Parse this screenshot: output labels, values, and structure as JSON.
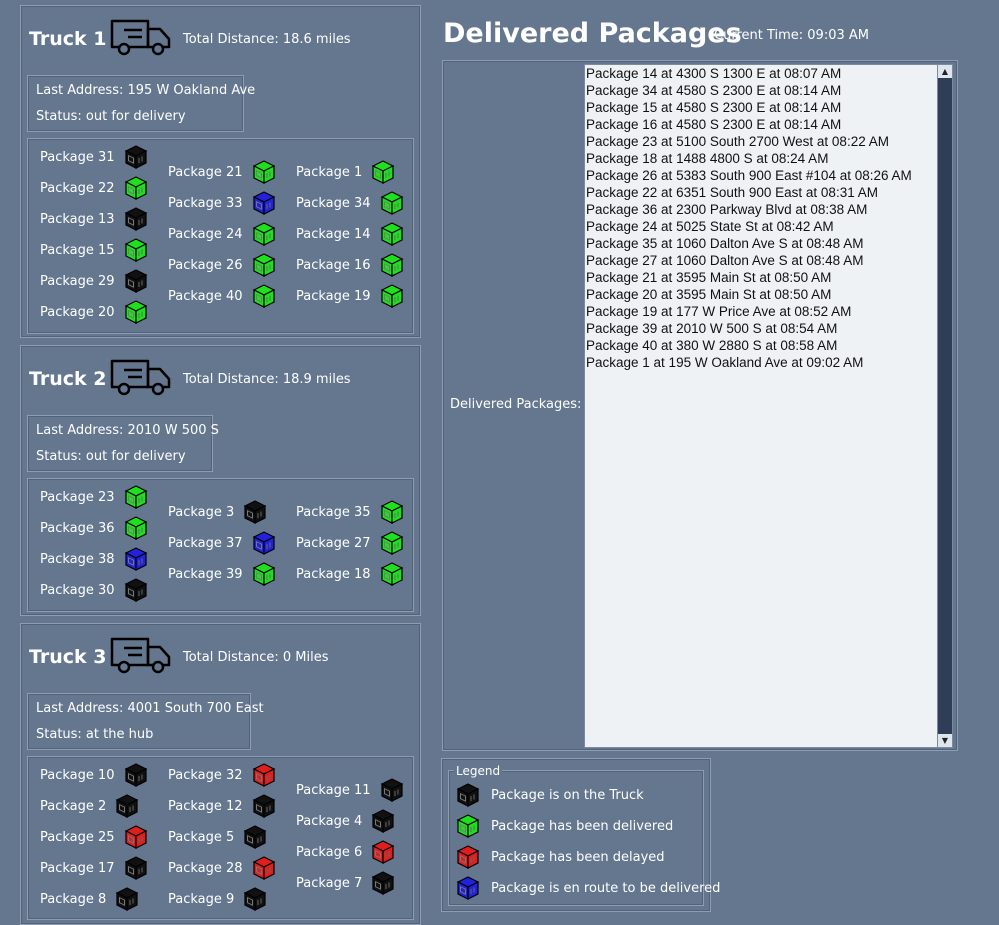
{
  "colors": {
    "bg": "#64778f",
    "onTruck": "#111111",
    "delivered": "#1ee01e",
    "delayed": "#e01e1e",
    "enroute": "#2222dd"
  },
  "trucks": [
    {
      "title": "Truck 1",
      "distance": "Total Distance: 18.6 miles",
      "last_address": "Last Address: 195 W Oakland Ave",
      "status": "Status: out for delivery",
      "columns": [
        [
          {
            "label": "Package 31",
            "state": "onTruck"
          },
          {
            "label": "Package 22",
            "state": "delivered"
          },
          {
            "label": "Package 13",
            "state": "onTruck"
          },
          {
            "label": "Package 15",
            "state": "delivered"
          },
          {
            "label": "Package 29",
            "state": "onTruck"
          },
          {
            "label": "Package 20",
            "state": "delivered"
          }
        ],
        [
          {
            "label": "Package 21",
            "state": "delivered"
          },
          {
            "label": "Package 33",
            "state": "enroute"
          },
          {
            "label": "Package 24",
            "state": "delivered"
          },
          {
            "label": "Package 26",
            "state": "delivered"
          },
          {
            "label": "Package 40",
            "state": "delivered"
          }
        ],
        [
          {
            "label": "Package 1",
            "state": "delivered"
          },
          {
            "label": "Package 34",
            "state": "delivered"
          },
          {
            "label": "Package 14",
            "state": "delivered"
          },
          {
            "label": "Package 16",
            "state": "delivered"
          },
          {
            "label": "Package 19",
            "state": "delivered"
          }
        ]
      ]
    },
    {
      "title": "Truck 2",
      "distance": "Total Distance: 18.9 miles",
      "last_address": "Last Address: 2010 W 500 S",
      "status": "Status: out for delivery",
      "columns": [
        [
          {
            "label": "Package 23",
            "state": "delivered"
          },
          {
            "label": "Package 36",
            "state": "delivered"
          },
          {
            "label": "Package 38",
            "state": "enroute"
          },
          {
            "label": "Package 30",
            "state": "onTruck"
          }
        ],
        [
          {
            "label": "Package 3",
            "state": "onTruck"
          },
          {
            "label": "Package 37",
            "state": "enroute"
          },
          {
            "label": "Package 39",
            "state": "delivered"
          }
        ],
        [
          {
            "label": "Package 35",
            "state": "delivered"
          },
          {
            "label": "Package 27",
            "state": "delivered"
          },
          {
            "label": "Package 18",
            "state": "delivered"
          }
        ]
      ]
    },
    {
      "title": "Truck 3",
      "distance": "Total Distance: 0 Miles",
      "last_address": "Last Address: 4001 South 700 East",
      "status": "Status: at the hub",
      "columns": [
        [
          {
            "label": "Package 10",
            "state": "onTruck"
          },
          {
            "label": "Package 2",
            "state": "onTruck"
          },
          {
            "label": "Package 25",
            "state": "delayed"
          },
          {
            "label": "Package 17",
            "state": "onTruck"
          },
          {
            "label": "Package 8",
            "state": "onTruck"
          }
        ],
        [
          {
            "label": "Package 32",
            "state": "delayed"
          },
          {
            "label": "Package 12",
            "state": "onTruck"
          },
          {
            "label": "Package 5",
            "state": "onTruck"
          },
          {
            "label": "Package 28",
            "state": "delayed"
          },
          {
            "label": "Package 9",
            "state": "onTruck"
          }
        ],
        [
          {
            "label": "Package 11",
            "state": "onTruck"
          },
          {
            "label": "Package 4",
            "state": "onTruck"
          },
          {
            "label": "Package 6",
            "state": "delayed"
          },
          {
            "label": "Package 7",
            "state": "onTruck"
          }
        ]
      ]
    }
  ],
  "header": {
    "title": "Delivered Packages",
    "current_time": "Current Time: 09:03 AM"
  },
  "delivered": {
    "label": "Delivered Packages:",
    "items": [
      "Package 14 at 4300 S 1300 E at 08:07 AM",
      "Package 34 at 4580 S 2300 E at 08:14 AM",
      "Package 15 at 4580 S 2300 E at 08:14 AM",
      "Package 16 at 4580 S 2300 E at 08:14 AM",
      "Package 23 at 5100 South 2700 West at 08:22 AM",
      "Package 18 at 1488 4800 S at 08:24 AM",
      "Package 26 at 5383 South 900 East #104 at 08:26 AM",
      "Package 22 at 6351 South 900 East at 08:31 AM",
      "Package 36 at 2300 Parkway Blvd at 08:38 AM",
      "Package 24 at 5025 State St at 08:42 AM",
      "Package 35 at 1060 Dalton Ave S at 08:48 AM",
      "Package 27 at 1060 Dalton Ave S at 08:48 AM",
      "Package 21 at 3595 Main St at 08:50 AM",
      "Package 20 at 3595 Main St at 08:50 AM",
      "Package 19 at 177 W Price Ave at 08:52 AM",
      "Package 39 at 2010 W 500 S at 08:54 AM",
      "Package 40 at 380 W 2880 S at 08:58 AM",
      "Package 1 at 195 W Oakland Ave at 09:02 AM"
    ]
  },
  "legend": {
    "title": "Legend",
    "items": [
      {
        "state": "onTruck",
        "label": "Package is on the Truck"
      },
      {
        "state": "delivered",
        "label": "Package has been delivered"
      },
      {
        "state": "delayed",
        "label": "Package has been delayed"
      },
      {
        "state": "enroute",
        "label": "Package is en route to be delivered"
      }
    ]
  }
}
